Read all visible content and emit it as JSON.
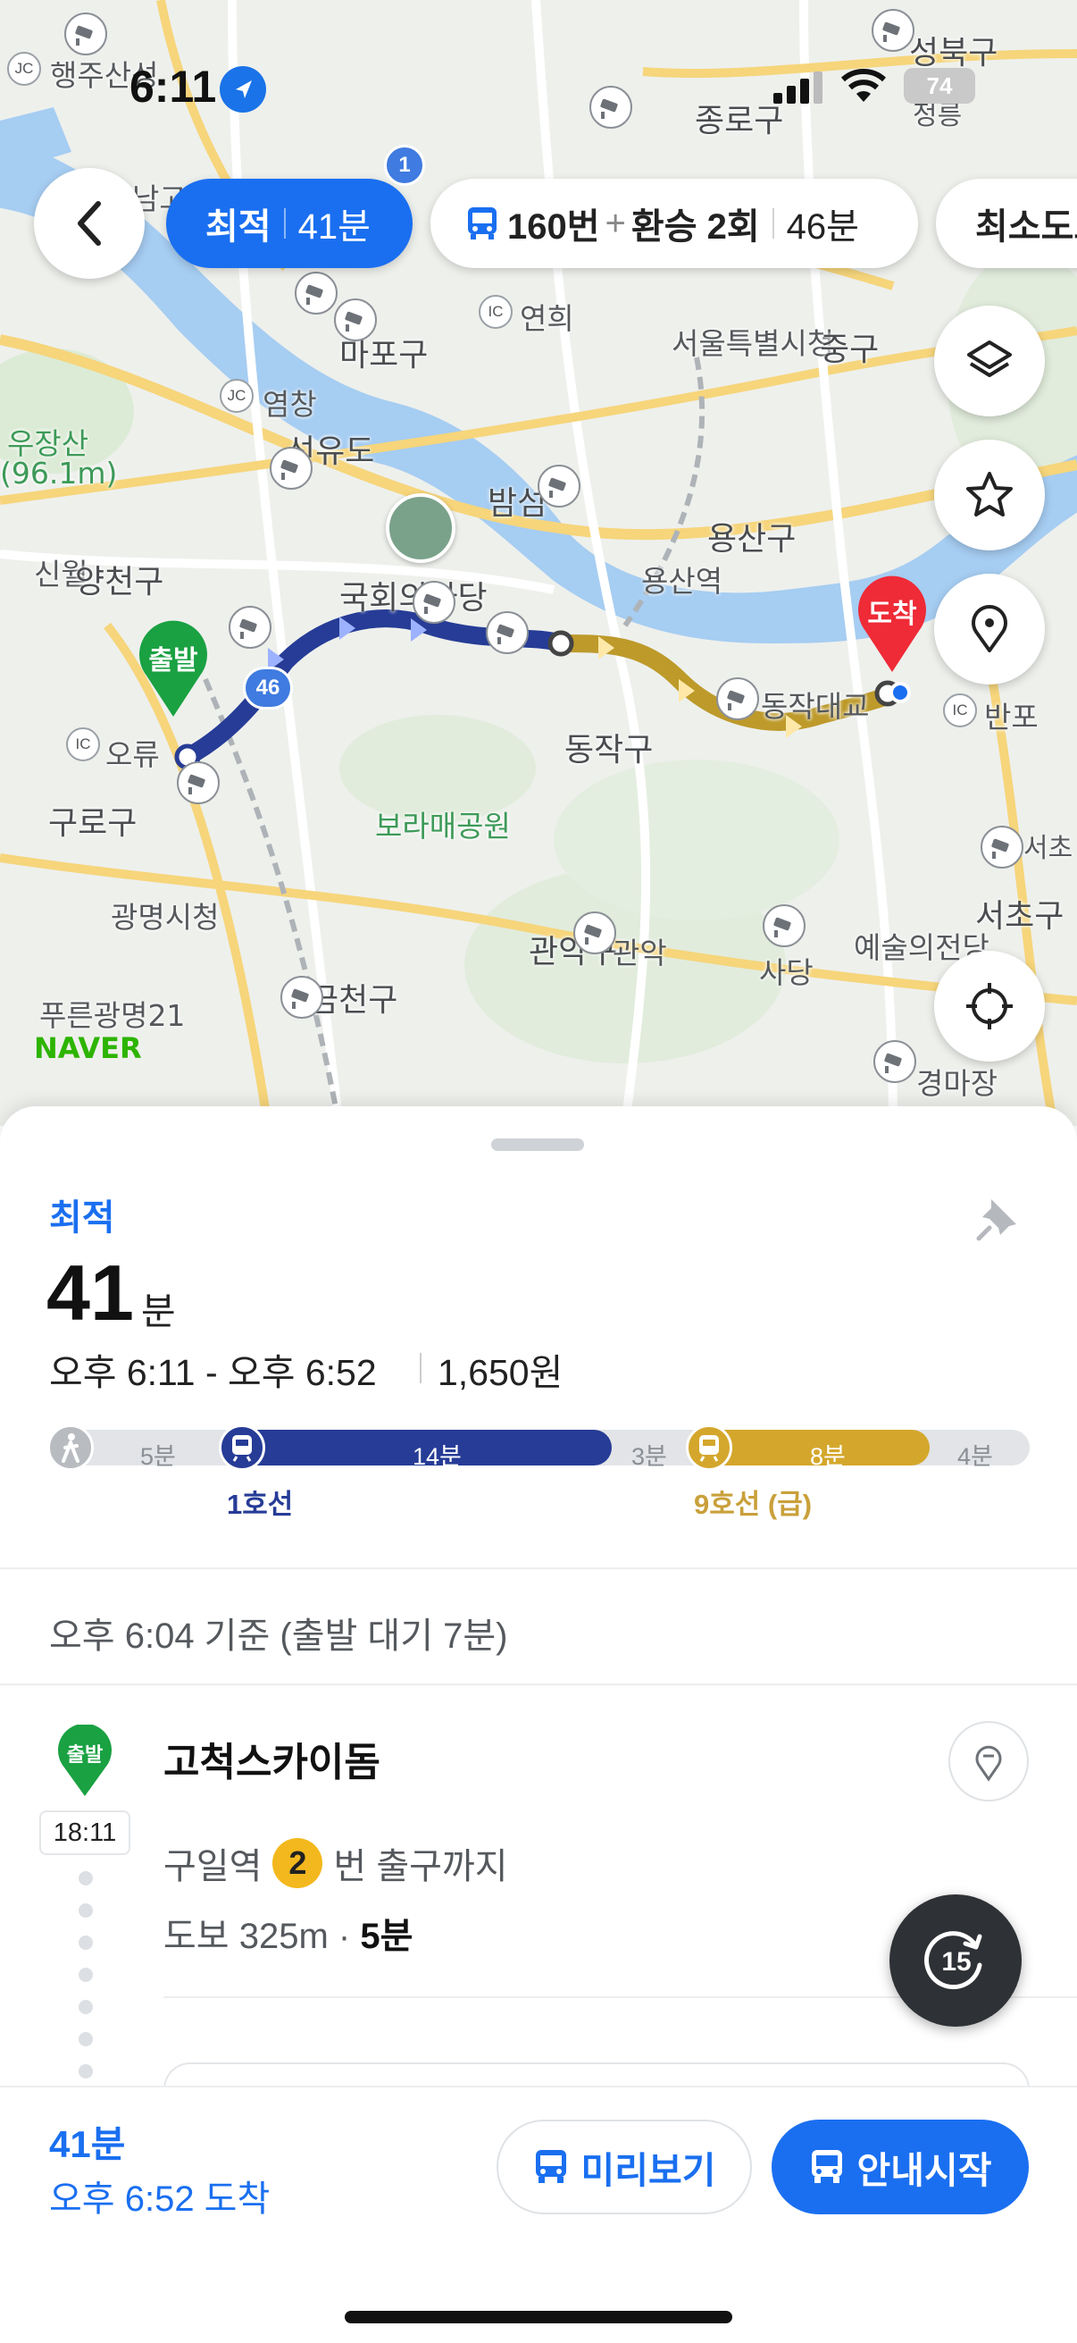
{
  "status_bar": {
    "time": "6:11",
    "battery": "74"
  },
  "route_tabs": [
    {
      "type": "최적",
      "duration": "41분"
    },
    {
      "bus": "160번",
      "plus": "+",
      "transfer": "환승 2회",
      "duration": "46분"
    },
    {
      "label": "최소도보"
    }
  ],
  "map": {
    "labels": {
      "haengju": "행주산성",
      "seongbuk": "성북구",
      "jongno": "종로구",
      "jeongneung": "정릉",
      "namgoyang": "남고양",
      "yeonhui": "연희",
      "seoul_cityhall": "서울특별시청",
      "jung": "중구",
      "mapo": "마포구",
      "yeomchang": "염창",
      "wujangsan": "우장산",
      "wujangsan_height": "(96.1m)",
      "seonyudo": "선유도",
      "bamseom": "밤섬",
      "yongsan": "용산구",
      "yongsan_station": "용산역",
      "sinwol": "신월",
      "yangcheon": "양천구",
      "national_assembly": "국회의사당",
      "dongjak_bridge": "동작대교",
      "banpo": "반포",
      "oryu": "오류",
      "dongjak": "동작구",
      "guro": "구로구",
      "boramae": "보라매공원",
      "gwangmyeong_cityhall": "광명시청",
      "seocho_station": "서초",
      "seocho": "서초구",
      "gwanak": "관악구",
      "gwanak_st": "관악",
      "sadang": "사당",
      "arts_center": "예술의전당",
      "purun": "푸른광명21",
      "geumcheon": "금천구",
      "gyeongmajang": "경마장",
      "naver": "NAVER",
      "badge_1": "1",
      "badge_46": "46",
      "ic": "IC",
      "jc": "JC"
    },
    "markers": {
      "start": "출발",
      "end": "도착"
    },
    "colors": {
      "line1": "#263c96",
      "line9": "#bd9a2a",
      "start": "#1aa142",
      "end": "#ee2b36"
    }
  },
  "sheet": {
    "route_type": "최적",
    "duration_num": "41",
    "duration_unit": "분",
    "time_range": "오후 6:11 - 오후 6:52",
    "fare": "1,650원",
    "segments": {
      "walk1": "5분",
      "line1_time": "14분",
      "walk2": "3분",
      "line9_time": "8분",
      "walk3": "4분",
      "line1_name": "1호선",
      "line9_name": "9호선 (급)"
    },
    "reference": "오후 6:04 기준 (출발 대기 7분)",
    "start": {
      "pin_label": "출발",
      "name": "고척스카이돔",
      "time": "18:11",
      "station_prefix": "구일역",
      "exit_no": "2",
      "station_suffix": "번 출구까지",
      "walk_prefix": "도보 325m · ",
      "walk_time": "5분"
    },
    "replay_label": "15"
  },
  "action_bar": {
    "duration": "41분",
    "arrival": "오후 6:52 도착",
    "preview": "미리보기",
    "start_guide": "안내시작"
  }
}
